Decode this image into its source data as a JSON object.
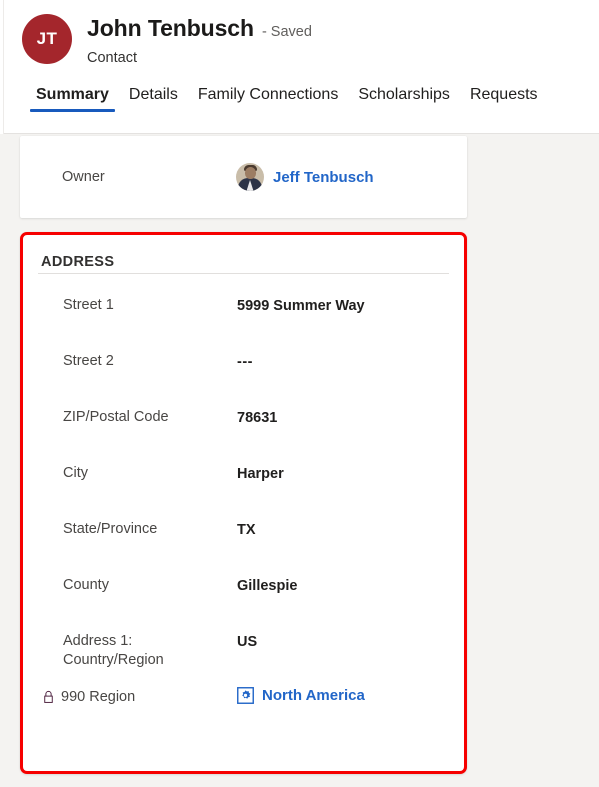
{
  "header": {
    "avatar_initials": "JT",
    "avatar_color": "#a4262c",
    "record_name": "John Tenbusch",
    "save_status": "- Saved",
    "record_type": "Contact"
  },
  "tabs": [
    {
      "label": "Summary",
      "active": true
    },
    {
      "label": "Details",
      "active": false
    },
    {
      "label": "Family Connections",
      "active": false
    },
    {
      "label": "Scholarships",
      "active": false
    },
    {
      "label": "Requests",
      "active": false
    }
  ],
  "owner_section": {
    "label": "Owner",
    "required_marker": "*",
    "value": "Jeff Tenbusch",
    "avatar_icon": "person-photo-avatar"
  },
  "address_section": {
    "title": "ADDRESS",
    "highlight_color": "#f60000",
    "fields": [
      {
        "label": "Street 1",
        "value": "5999 Summer Way",
        "locked": false,
        "link": false
      },
      {
        "label": "Street 2",
        "value": "---",
        "locked": false,
        "link": false
      },
      {
        "label": "ZIP/Postal Code",
        "value": "78631",
        "locked": false,
        "link": false
      },
      {
        "label": "City",
        "value": "Harper",
        "locked": false,
        "link": false
      },
      {
        "label": "State/Province",
        "value": "TX",
        "locked": false,
        "link": false
      },
      {
        "label": "County",
        "value": "Gillespie",
        "locked": false,
        "link": false
      },
      {
        "label": "Address 1: Country/Region",
        "value": "US",
        "locked": false,
        "link": false
      },
      {
        "label": "990 Region",
        "value": "North America",
        "locked": true,
        "link": true,
        "lock_icon": "lock-icon",
        "value_icon": "entity-record-icon"
      }
    ]
  }
}
